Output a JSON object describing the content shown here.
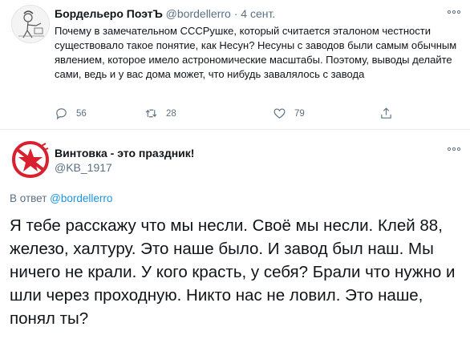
{
  "tweet1": {
    "author_name": "Бордельеро ПоэтЪ",
    "author_handle": "@bordellerro",
    "separator": "·",
    "date": "4 сент.",
    "text": "Почему в замечательном СССРушке, который считается эталоном честности существовало такое понятие, как Несун? Несуны с заводов были самым обычным явлением, которое имело астрономические масштабы. Поэтому, выводы делайте сами, ведь и у вас дома может, что нибудь завалялось с завода",
    "more_label": "ooo",
    "reply_count": "56",
    "retweet_count": "28",
    "like_count": "79",
    "icons": {
      "reply": "reply-icon",
      "retweet": "retweet-icon",
      "like": "heart-icon",
      "share": "share-icon"
    }
  },
  "tweet2": {
    "author_name": "Винтовка - это праздник!",
    "author_handle": "@KB_1917",
    "more_label": "ooo",
    "reply_prefix": "В ответ ",
    "reply_mention": "@bordellerro",
    "text": "Я тебе расскажу что мы несли. Своё мы несли. Клей 88, железо, халтуру. Это наше было. И завод был наш. Мы ничего не крали. У кого красть, у себя? Брали что нужно и шли через проходную. Никто нас не ловил. Это наше, понял ты?"
  },
  "colors": {
    "secondary_text": "#5b7083",
    "link": "#1b95e0",
    "divider": "#e6ecf0",
    "avatar_red": "#d8202e"
  }
}
